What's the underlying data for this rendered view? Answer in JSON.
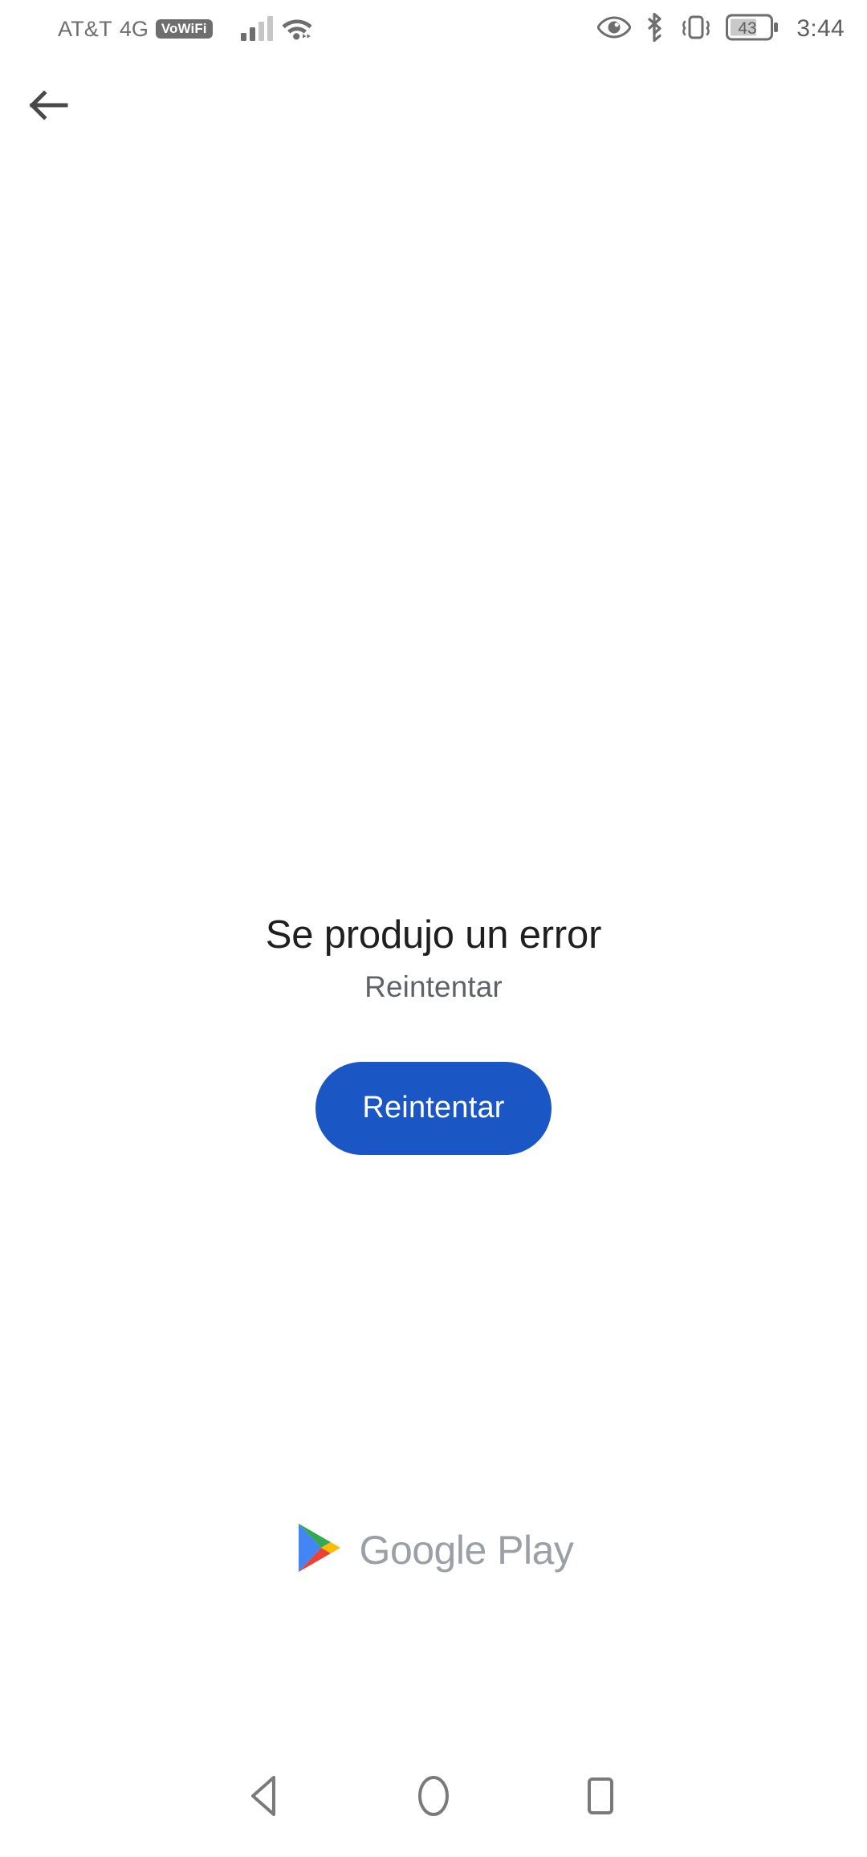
{
  "status_bar": {
    "carrier": "AT&T",
    "network_type": "4G",
    "vowifi_badge": "VoWiFi",
    "signal_icon": "signal-bars-icon",
    "wifi_icon": "wifi-icon",
    "eye_icon": "eye-icon",
    "bluetooth_icon": "bluetooth-icon",
    "vibrate_icon": "vibrate-icon",
    "battery_icon": "battery-icon",
    "battery_level": "43",
    "time": "3:44"
  },
  "topbar": {
    "back_icon": "arrow-left-icon"
  },
  "main": {
    "error_title": "Se produjo un error",
    "error_subtitle": "Reintentar",
    "retry_label": "Reintentar"
  },
  "brand": {
    "logo_icon": "google-play-logo-icon",
    "name": "Google Play"
  },
  "navbar": {
    "back_icon": "nav-back-triangle-icon",
    "home_icon": "nav-home-circle-icon",
    "recents_icon": "nav-recents-square-icon"
  },
  "colors": {
    "accent_blue": "#1a56c4",
    "text_primary": "#1f1f1f",
    "text_secondary": "#5f6368",
    "brand_gray": "#9aa0a6",
    "status_gray": "#6e6e6e",
    "nav_gray": "#7a7a7a",
    "play_blue": "#4285f4",
    "play_green": "#34a853",
    "play_yellow": "#fbbc04",
    "play_red": "#ea4335"
  }
}
